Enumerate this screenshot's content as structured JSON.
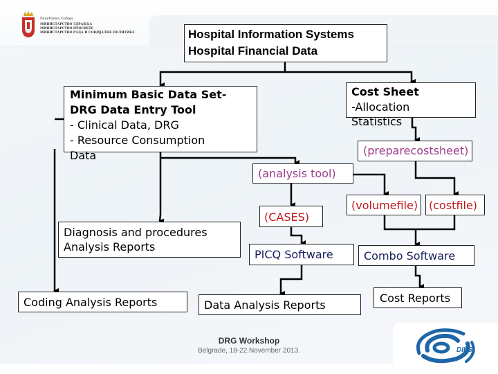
{
  "header": {
    "crest": "serbia-coat-of-arms-icon",
    "ministry_lines": [
      "Република Србија",
      "МИНИСТАРСТВО ЗДРАВЉА",
      "МИНИСТАРСТВО ПРОСВЕТЕ",
      "МИНИСТАРСТВО РАДА И СОЦИЈАЛНЕ ПОЛИТИКЕ"
    ]
  },
  "diagram": {
    "title": {
      "line1": "Hospital Information Systems",
      "line2": "Hospital Financial Data"
    },
    "mbds": {
      "line1": "Minimum Basic Data Set-",
      "line2": "DRG Data Entry Tool",
      "line3": "- Clinical Data, DRG",
      "line4": "- Resource Consumption",
      "line5": "Data"
    },
    "cost_sheet": {
      "line1": "Cost Sheet",
      "line2": "-Allocation",
      "line3": "Statistics"
    },
    "preparecostsheet": "(preparecostsheet)",
    "analysis_tool": "(analysis tool)",
    "cases": "(CASES)",
    "volumefile": "(volumefile)",
    "costfile": "(costfile)",
    "picq": "PICQ Software",
    "combo": "Combo Software",
    "diag_reports": {
      "line1": "Diagnosis and procedures",
      "line2": "Analysis Reports"
    },
    "coding_reports": "Coding Analysis Reports",
    "data_analysis_reports": "Data Analysis Reports",
    "cost_reports": "Cost Reports"
  },
  "colors": {
    "purple": "#9b3b8c",
    "red": "#c0181c",
    "navy": "#1a1f5c",
    "logo_blue": "#1d66a8"
  },
  "footer": {
    "title": "DRG Workshop",
    "subtitle": "Belgrade, 18-22.November 2013."
  },
  "logo": {
    "text": "DILS"
  }
}
